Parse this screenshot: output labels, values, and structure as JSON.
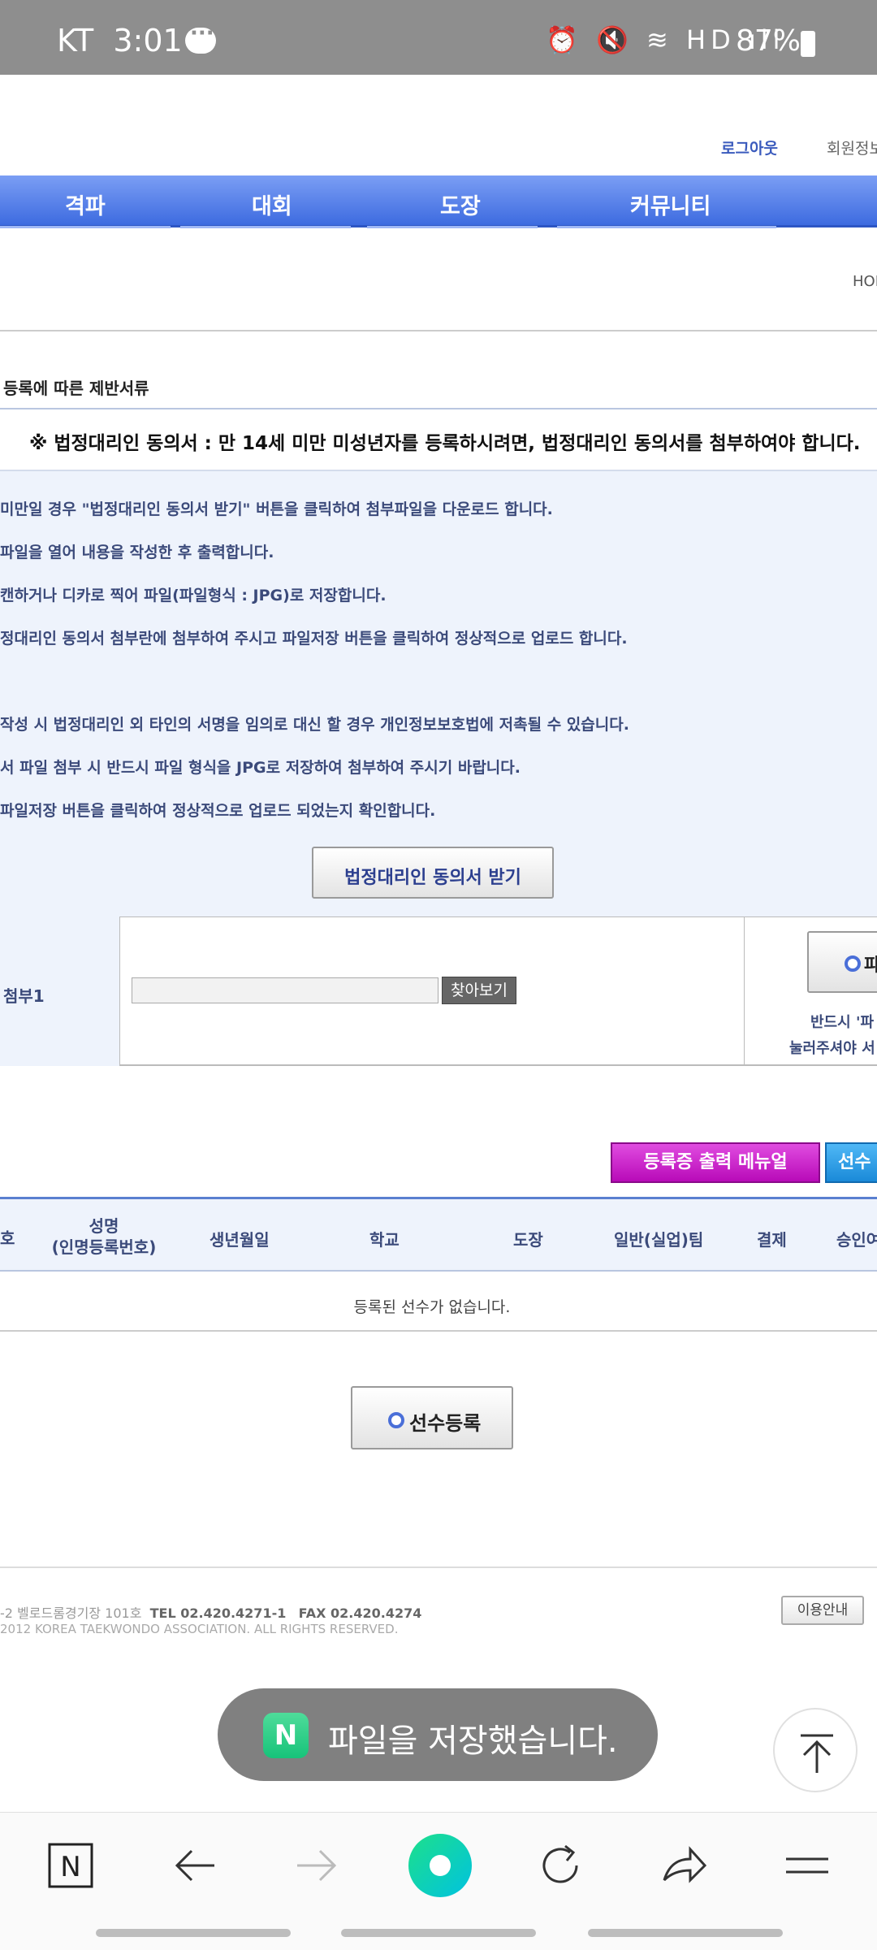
{
  "status_bar": {
    "carrier": "KT",
    "time": "3:01",
    "battery": "87%",
    "icons": [
      "chat-bubble-icon",
      "alarm-icon",
      "mute-icon",
      "wifi-icon",
      "hd-icon",
      "signal-icon",
      "battery-icon"
    ]
  },
  "top_links": {
    "logout": "로그아웃",
    "member_info": "회원정보"
  },
  "nav": {
    "items": [
      "격파",
      "대회",
      "도장",
      "커뮤니티"
    ]
  },
  "breadcrumb": {
    "home": "HOME"
  },
  "section_title": "등록에 따른 제반서류",
  "notice": {
    "title": "※ 법정대리인 동의서 : 만 14세 미만 미성년자를 등록하시려면, 법정대리인 동의서를 첨부하여야 합니다.",
    "lines": [
      "미만일 경우 \"법정대리인 동의서 받기\" 버튼을 클릭하여 첨부파일을 다운로드 합니다.",
      "파일을 열어 내용을 작성한 후 출력합니다.",
      "캔하거나 디카로 찍어 파일(파일형식 : JPG)로 저장합니다.",
      "정대리인 동의서 첨부란에 첨부하여 주시고 파일저장 버튼을 클릭하여 정상적으로 업로드 합니다.",
      "작성 시 법정대리인 외 타인의 서명을 임의로 대신 할 경우 개인정보보호법에 저촉될 수 있습니다.",
      "서 파일 첨부 시 반드시 파일 형식을 JPG로 저장하여 첨부하여 주시기 바랍니다.",
      "파일저장 버튼을 클릭하여 정상적으로 업로드 되었는지 확인합니다."
    ],
    "consent_button": "법정대리인 동의서 받기"
  },
  "attach": {
    "label": "첨부1",
    "browse_button": "찾아보기",
    "save_button": "파",
    "note_line1": "반드시 '파",
    "note_line2": "눌러주셔야 서"
  },
  "actions": {
    "print_manual": "등록증 출력 메뉴얼",
    "player": "선수"
  },
  "table": {
    "headers": [
      "호",
      "성명",
      "(인명등록번호)",
      "생년월일",
      "학교",
      "도장",
      "일반(실업)팀",
      "결제",
      "승인여"
    ],
    "empty_message": "등록된 선수가 없습니다."
  },
  "register_button": "선수등록",
  "footer": {
    "address": "-2 벨로드롬경기장 101호",
    "tel": "TEL 02.420.4271-1",
    "fax": "FAX 02.420.4274",
    "copyright": "2012 KOREA TAEKWONDO ASSOCIATION. ALL RIGHTS RESERVED.",
    "usage_button": "이용안내"
  },
  "toast": {
    "badge": "N",
    "message": "파일을 저장했습니다."
  },
  "bottom_bar": {
    "items": [
      "naver-home-icon",
      "back-icon",
      "forward-icon",
      "green-dot-icon",
      "refresh-icon",
      "share-icon",
      "menu-icon"
    ]
  }
}
